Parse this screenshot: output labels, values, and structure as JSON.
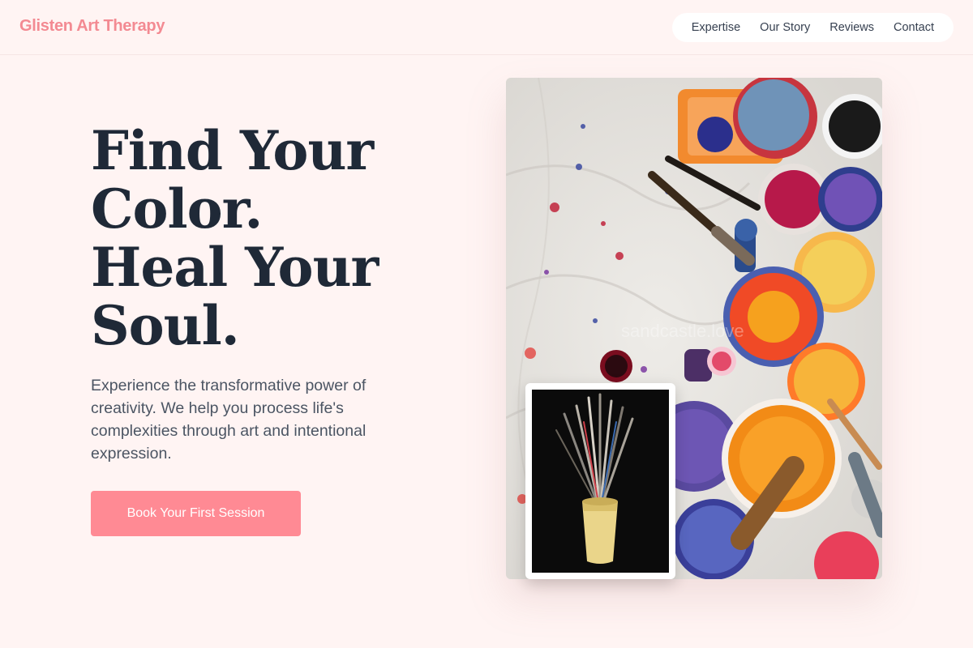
{
  "brand": {
    "name": "Glisten Art Therapy"
  },
  "nav": {
    "items": [
      "Expertise",
      "Our Story",
      "Reviews",
      "Contact"
    ]
  },
  "hero": {
    "title_lines": [
      "Find Your",
      "Color.",
      "Heal Your",
      "Soul."
    ],
    "subtitle": "Experience the transformative power of creativity. We help you process life's complexities through art and intentional expression.",
    "cta_label": "Book Your First Session"
  },
  "images": {
    "main_watermark": "sandcastle.love",
    "main_subject": "paint-palettes-on-drop-cloth",
    "inset_subject": "paintbrushes-in-cup"
  },
  "colors": {
    "brand": "#f38a92",
    "cta": "#ff8a94",
    "background": "#fff4f3",
    "heading": "#1f2937",
    "body": "#4b5563"
  }
}
